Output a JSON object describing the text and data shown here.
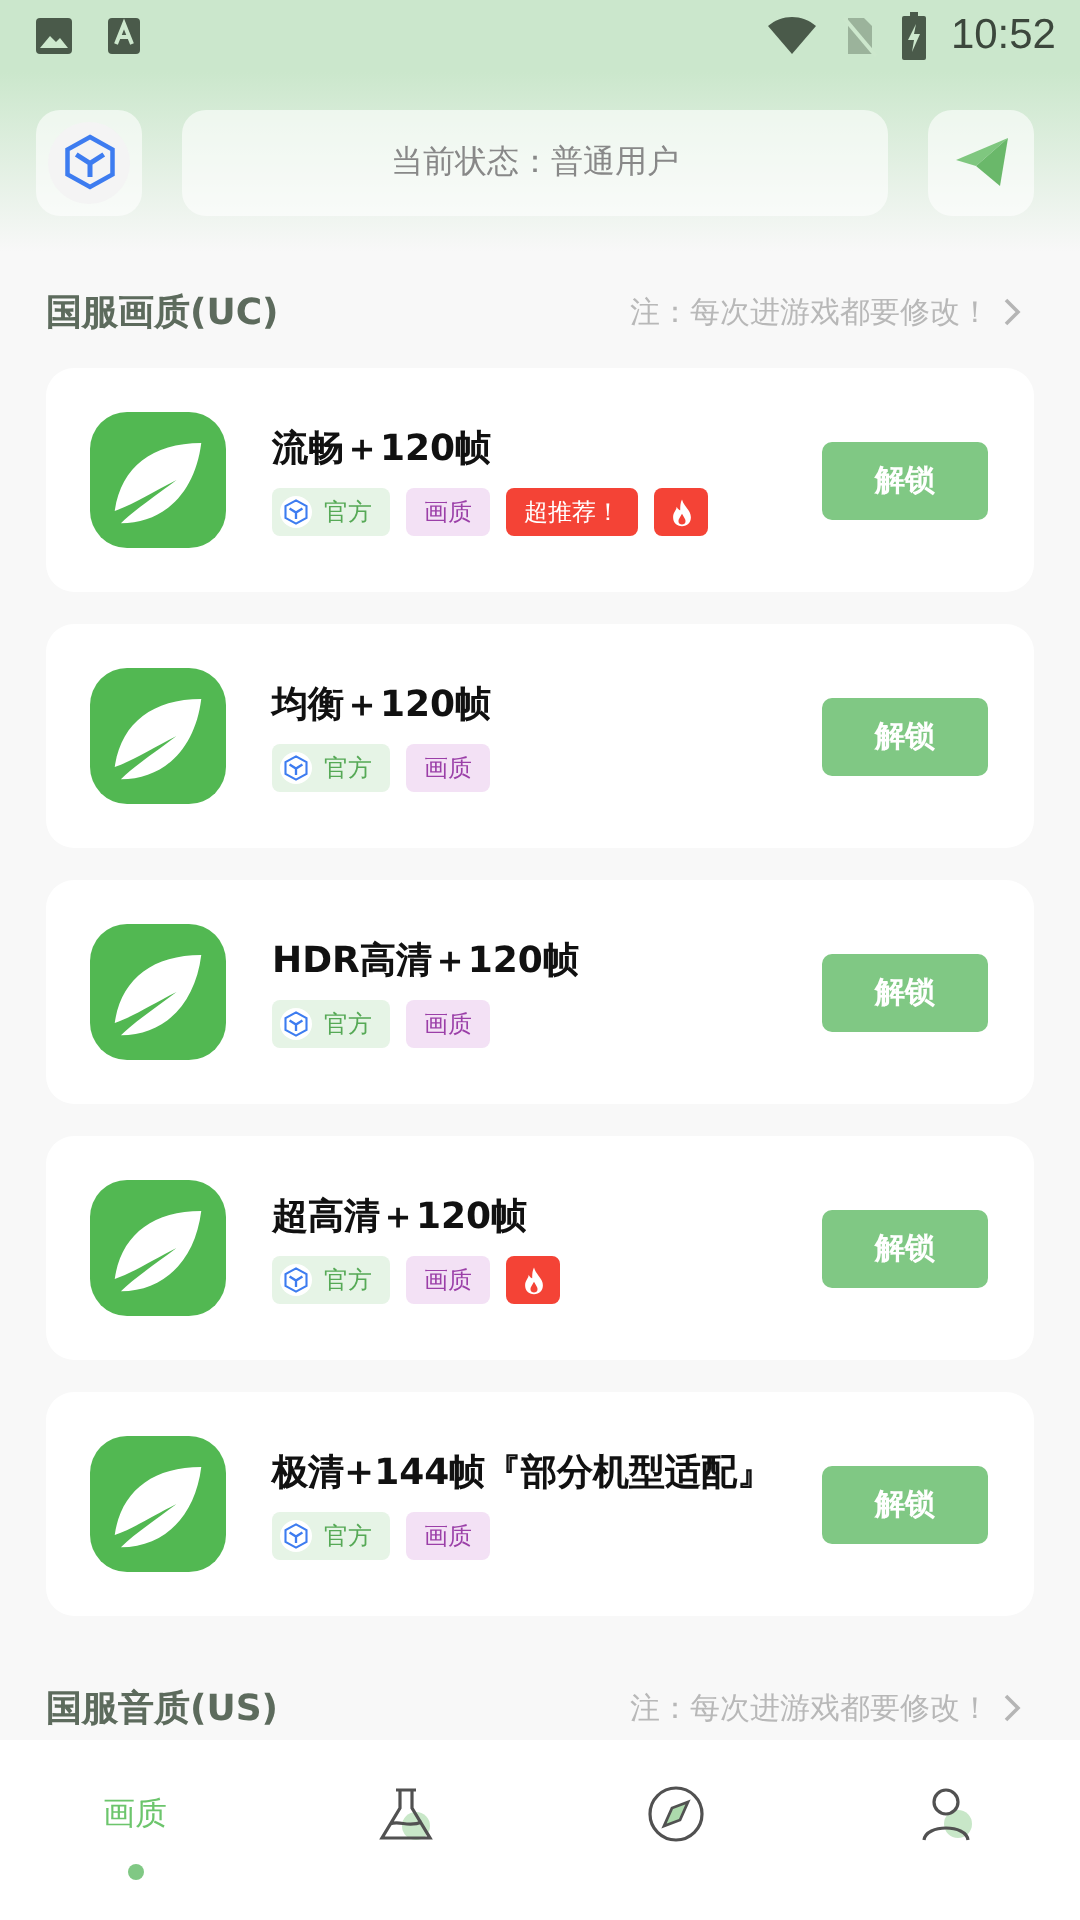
{
  "status_bar": {
    "time": "10:52"
  },
  "header": {
    "status_text": "当前状态：普通用户"
  },
  "sections": [
    {
      "title": "国服画质(UC)",
      "note": "注：每次进游戏都要修改！",
      "items": [
        {
          "name": "流畅＋120帧",
          "button": "解锁",
          "tags": [
            {
              "kind": "official",
              "label": "官方"
            },
            {
              "kind": "quality",
              "label": "画质"
            },
            {
              "kind": "recommend",
              "label": "超推荐！"
            },
            {
              "kind": "hot"
            }
          ]
        },
        {
          "name": "均衡＋120帧",
          "button": "解锁",
          "tags": [
            {
              "kind": "official",
              "label": "官方"
            },
            {
              "kind": "quality",
              "label": "画质"
            }
          ]
        },
        {
          "name": "HDR高清＋120帧",
          "button": "解锁",
          "tags": [
            {
              "kind": "official",
              "label": "官方"
            },
            {
              "kind": "quality",
              "label": "画质"
            }
          ]
        },
        {
          "name": "超高清＋120帧",
          "button": "解锁",
          "tags": [
            {
              "kind": "official",
              "label": "官方"
            },
            {
              "kind": "quality",
              "label": "画质"
            },
            {
              "kind": "hot"
            }
          ]
        },
        {
          "name": "极清+144帧『部分机型适配』",
          "button": "解锁",
          "tags": [
            {
              "kind": "official",
              "label": "官方"
            },
            {
              "kind": "quality",
              "label": "画质"
            }
          ]
        }
      ]
    },
    {
      "title": "国服音质(US)",
      "note": "注：每次进游戏都要修改！"
    }
  ],
  "nav": [
    {
      "kind": "label",
      "label": "画质",
      "selected": true
    },
    {
      "kind": "flask",
      "selected": false
    },
    {
      "kind": "compass",
      "selected": false
    },
    {
      "kind": "person",
      "selected": false
    }
  ]
}
